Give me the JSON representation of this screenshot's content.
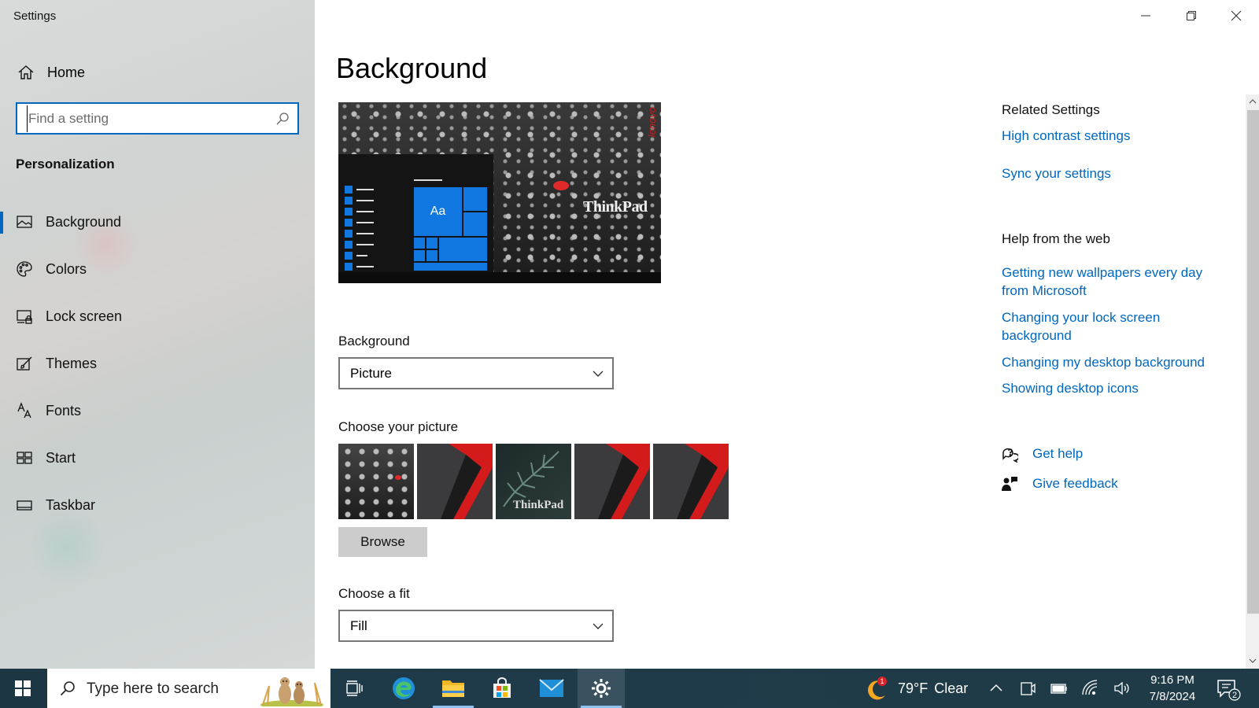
{
  "window": {
    "title": "Settings",
    "controls": [
      "minimize",
      "restore",
      "close"
    ]
  },
  "sidebar": {
    "home_label": "Home",
    "search_placeholder": "Find a setting",
    "section": "Personalization",
    "items": [
      {
        "label": "Background",
        "icon": "picture-icon",
        "selected": true
      },
      {
        "label": "Colors",
        "icon": "palette-icon"
      },
      {
        "label": "Lock screen",
        "icon": "lock-screen-icon"
      },
      {
        "label": "Themes",
        "icon": "brush-icon"
      },
      {
        "label": "Fonts",
        "icon": "fonts-icon"
      },
      {
        "label": "Start",
        "icon": "start-icon"
      },
      {
        "label": "Taskbar",
        "icon": "taskbar-icon"
      }
    ]
  },
  "main": {
    "title": "Background",
    "preview": {
      "tile_text": "Aa",
      "brand_text": "ThinkPad",
      "maker_text": "lenovo"
    },
    "background_label": "Background",
    "background_value": "Picture",
    "choose_picture_label": "Choose your picture",
    "thumb_text": "ThinkPad",
    "browse_label": "Browse",
    "fit_label": "Choose a fit",
    "fit_value": "Fill"
  },
  "related": {
    "heading": "Related Settings",
    "links": [
      "High contrast settings",
      "Sync your settings"
    ]
  },
  "help_web": {
    "heading": "Help from the web",
    "links": [
      "Getting new wallpapers every day from Microsoft",
      "Changing your lock screen background",
      "Changing my desktop background",
      "Showing desktop icons"
    ]
  },
  "support": {
    "get_help": "Get help",
    "give_feedback": "Give feedback"
  },
  "taskbar": {
    "search_placeholder": "Type here to search",
    "weather_badge": "1",
    "weather_temp": "79°F",
    "weather_cond": "Clear",
    "time": "9:16 PM",
    "date": "7/8/2024",
    "notification_count": "2",
    "colors": {
      "accent": "#0067c0",
      "taskbar": "#1f3b49"
    }
  }
}
